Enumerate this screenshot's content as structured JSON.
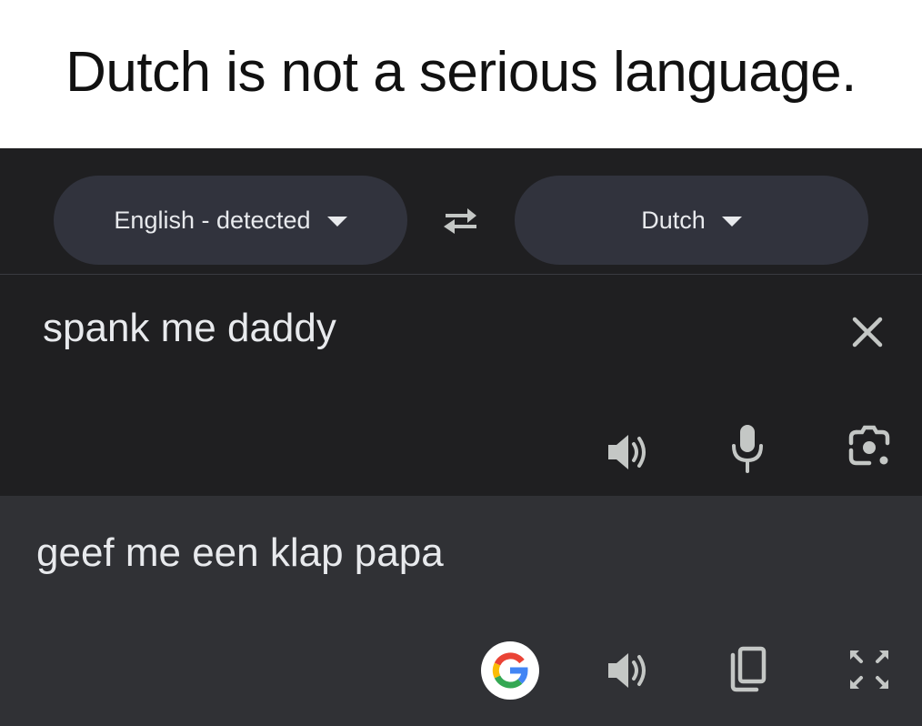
{
  "caption": {
    "text": "Dutch is not a serious language."
  },
  "translator": {
    "source_language": "English - detected",
    "target_language": "Dutch",
    "input_text": "spank me daddy",
    "output_text": "geef me een klap papa"
  },
  "icons": {
    "swap": "swap-arrows-icon",
    "clear": "close-icon",
    "input_speak": "speaker-icon",
    "mic": "microphone-icon",
    "camera": "camera-lens-icon",
    "google": "google-logo-icon",
    "output_speak": "speaker-icon",
    "copy": "copy-icon",
    "fullscreen": "fullscreen-icon"
  },
  "colors": {
    "background": "#1f1f21",
    "pill": "#31333d",
    "output_background": "#303135",
    "text": "#e8eaed",
    "icon": "#c4c7c5"
  }
}
